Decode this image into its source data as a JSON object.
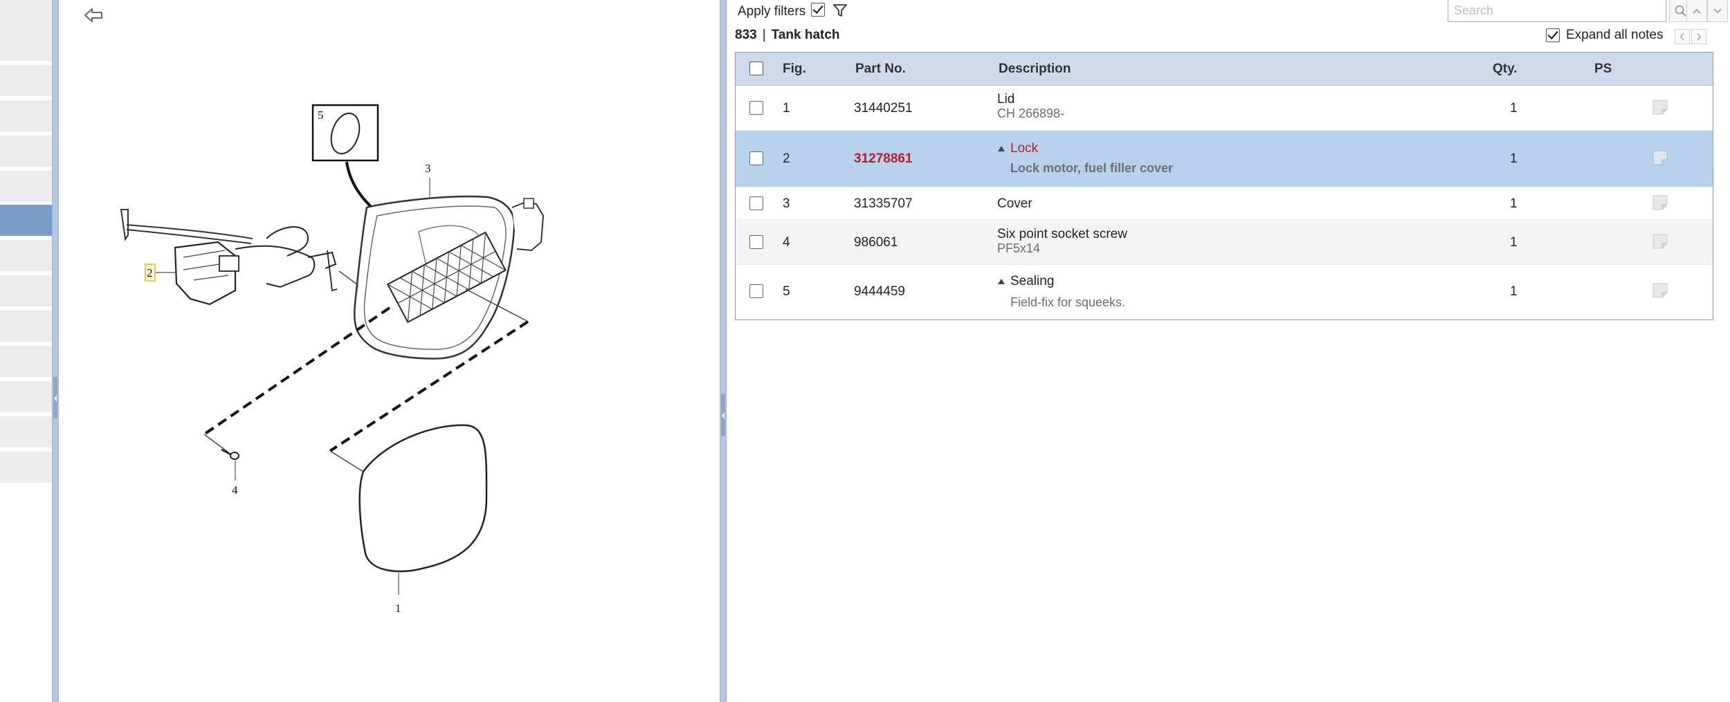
{
  "toolbar": {
    "apply_filters_label": "Apply filters",
    "apply_filters_checked": true,
    "search_placeholder": "Search",
    "expand_notes_label": "Expand all notes",
    "expand_notes_checked": true
  },
  "group": {
    "code": "833",
    "separator": "|",
    "name": "Tank hatch"
  },
  "table": {
    "headers": {
      "fig": "Fig.",
      "part_no": "Part No.",
      "description": "Description",
      "qty": "Qty.",
      "ps": "PS"
    },
    "rows": [
      {
        "fig": "1",
        "part_no": "31440251",
        "desc": "Lid",
        "note": "CH 266898-",
        "qty": "1",
        "expandable": false,
        "selected": false
      },
      {
        "fig": "2",
        "part_no": "31278861",
        "desc": "Lock",
        "note": "Lock motor, fuel filler cover",
        "qty": "1",
        "expandable": true,
        "selected": true
      },
      {
        "fig": "3",
        "part_no": "31335707",
        "desc": "Cover",
        "note": "",
        "qty": "1",
        "expandable": false,
        "selected": false
      },
      {
        "fig": "4",
        "part_no": "986061",
        "desc": "Six point socket screw",
        "note": "PF5x14",
        "qty": "1",
        "expandable": false,
        "selected": false
      },
      {
        "fig": "5",
        "part_no": "9444459",
        "desc": "Sealing",
        "note": "Field-fix for squeeks.",
        "qty": "1",
        "expandable": true,
        "selected": false
      }
    ]
  },
  "diagram": {
    "callouts": [
      "1",
      "2",
      "3",
      "4",
      "5"
    ],
    "highlighted_callout": "2"
  },
  "colors": {
    "selected_row": "#b8d2ee",
    "header": "#cfdbea",
    "accent_red": "#b3202a",
    "nav_active": "#7a9cc6",
    "callout_highlight": "#f2c230"
  },
  "icons": {
    "back": "back-arrow-icon",
    "filter": "funnel-icon",
    "search": "magnifier-icon",
    "note": "note-icon"
  }
}
